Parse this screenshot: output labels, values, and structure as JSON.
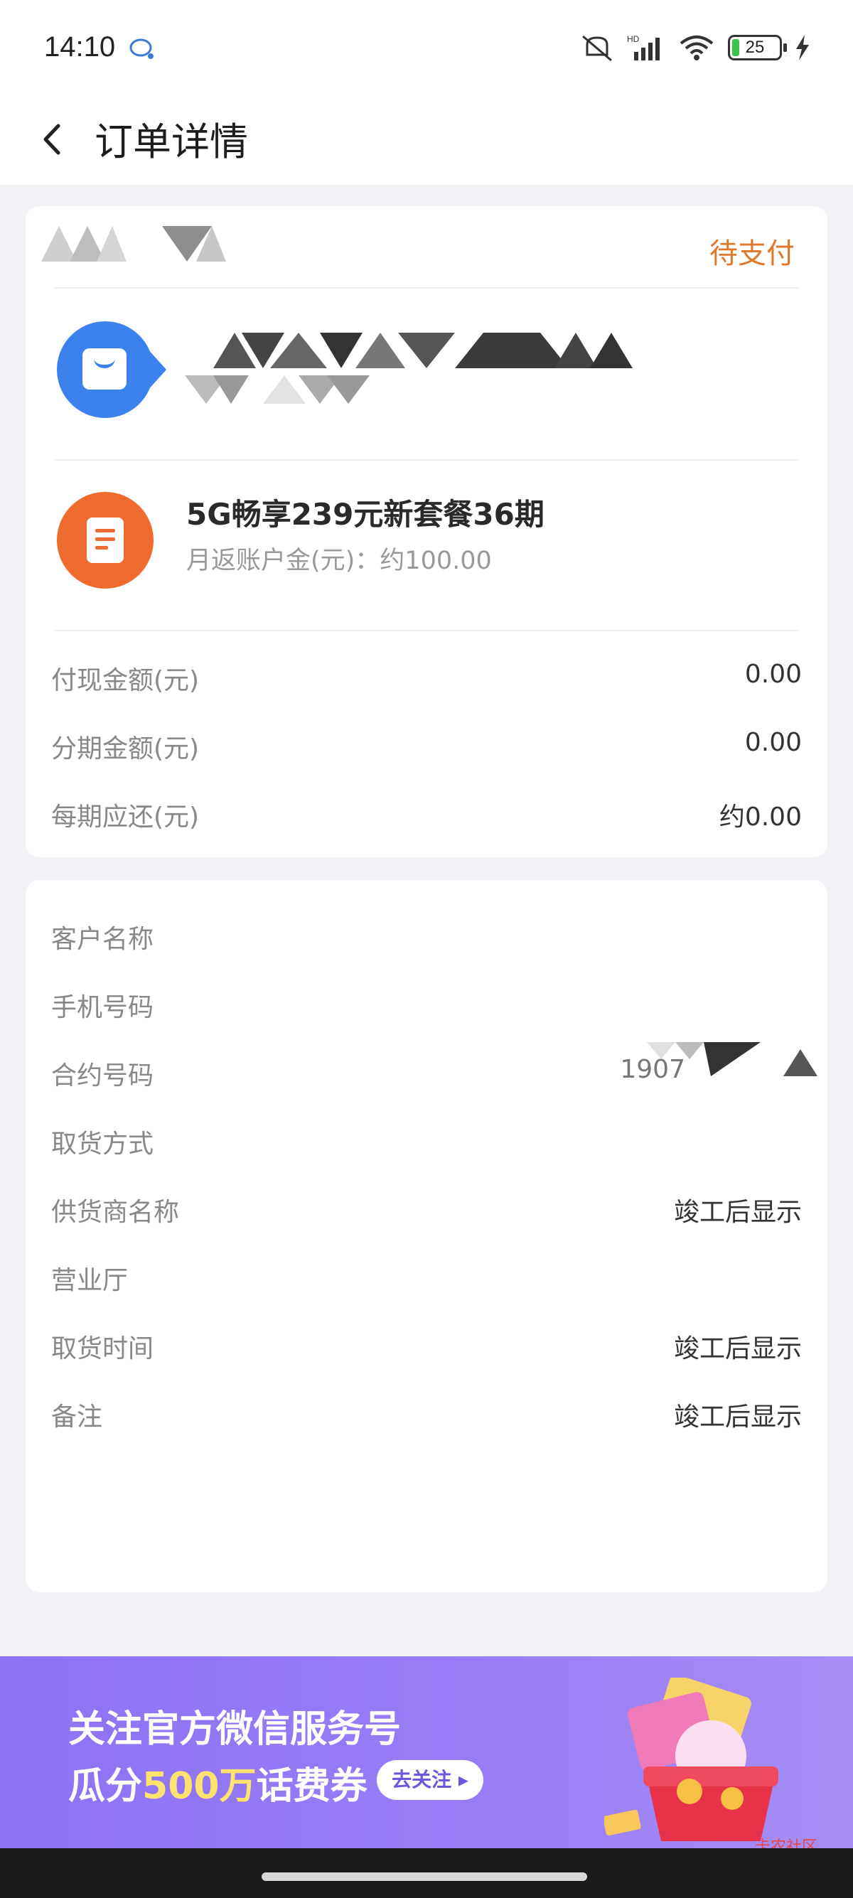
{
  "status_bar": {
    "time": "14:10",
    "battery_level": "25",
    "icons": [
      "chat-icon",
      "mute-icon",
      "signal-icon",
      "wifi-icon",
      "battery-icon",
      "charging-icon"
    ]
  },
  "header": {
    "title": "订单详情",
    "back_icon": "chevron-left-icon"
  },
  "order": {
    "status": "待支付",
    "product": {
      "name": "5G畅享239元新套餐36期",
      "subtitle": "月返账户金(元)：约100.00"
    },
    "amounts": [
      {
        "label": "付现金额(元)",
        "value": "0.00"
      },
      {
        "label": "分期金额(元)",
        "value": "0.00"
      },
      {
        "label": "每期应还(元)",
        "value": "约0.00"
      }
    ]
  },
  "details": [
    {
      "label": "客户名称",
      "value": ""
    },
    {
      "label": "手机号码",
      "value": ""
    },
    {
      "label": "合约号码",
      "value": "1907"
    },
    {
      "label": "取货方式",
      "value": ""
    },
    {
      "label": "供货商名称",
      "value": "竣工后显示"
    },
    {
      "label": "营业厅",
      "value": ""
    },
    {
      "label": "取货时间",
      "value": "竣工后显示"
    },
    {
      "label": "备注",
      "value": "竣工后显示"
    }
  ],
  "banner": {
    "line1": "关注官方微信服务号",
    "line2_prefix": "瓜分",
    "line2_highlight": "500万",
    "line2_suffix": "话费券",
    "button": "去关注 ▸",
    "watermark": "卡农社区"
  },
  "colors": {
    "accent_orange": "#e0782c",
    "shop_blue": "#3c82ee",
    "product_orange": "#ef6a2e",
    "banner_purple": "#8d72f4"
  }
}
